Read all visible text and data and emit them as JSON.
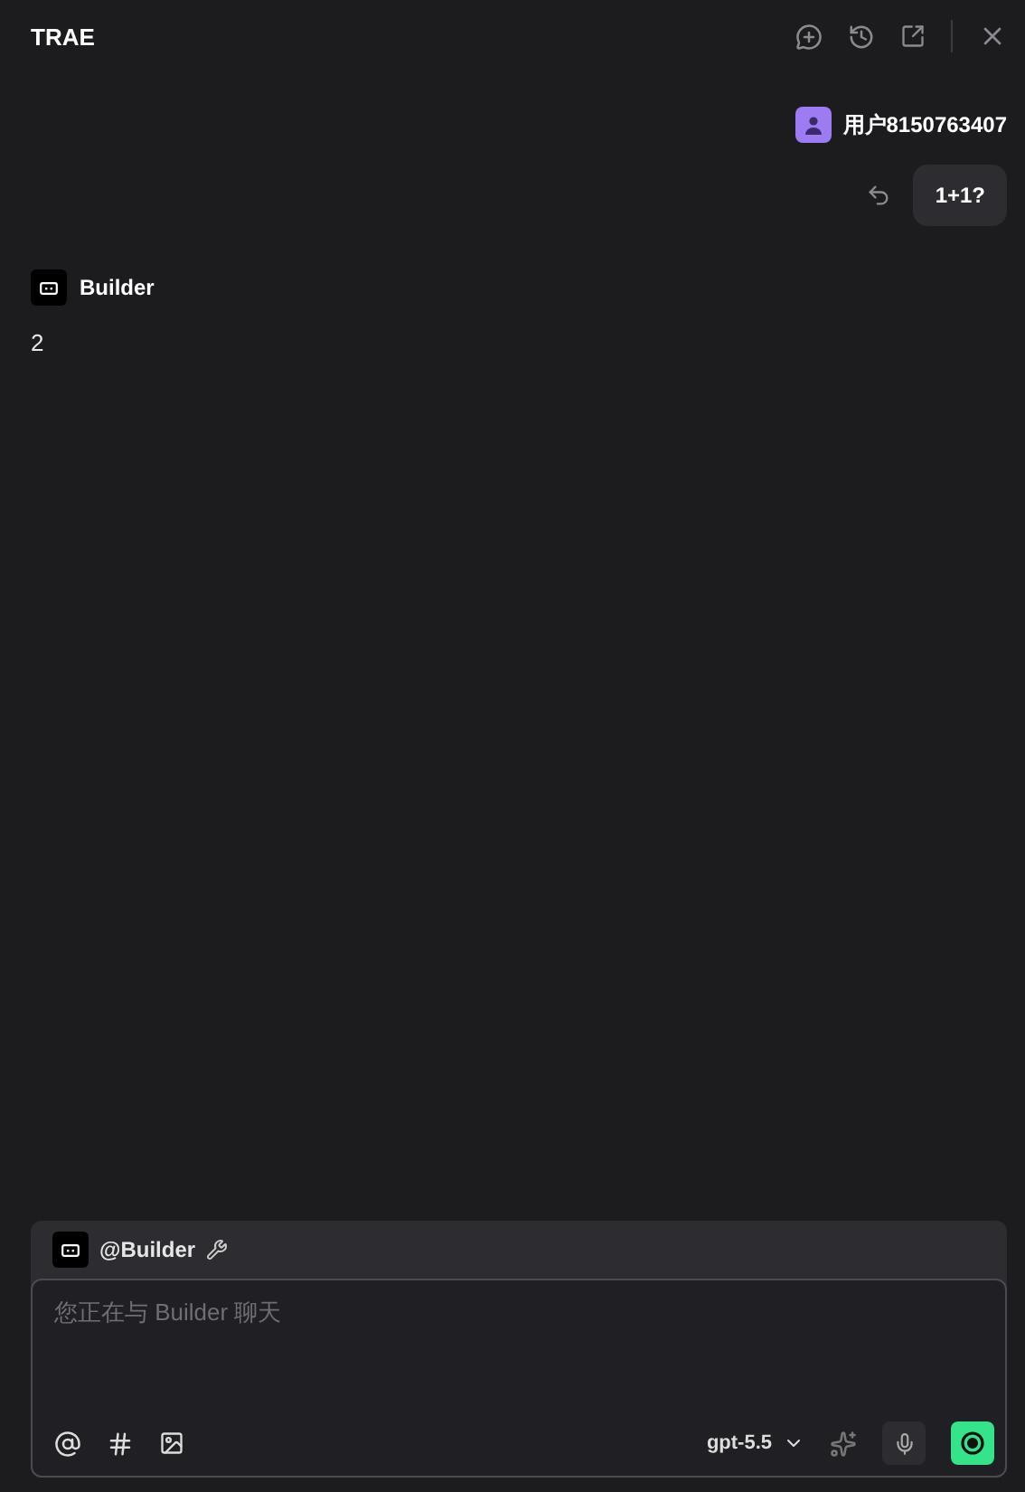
{
  "header": {
    "title": "TRAE"
  },
  "messages": [
    {
      "kind": "user",
      "author": "用户8150763407",
      "text": "1+1?"
    },
    {
      "kind": "agent",
      "author": "Builder",
      "text": "2"
    }
  ],
  "composer": {
    "agent": "@Builder",
    "placeholder": "您正在与 Builder 聊天",
    "model": "gpt-5.5"
  }
}
